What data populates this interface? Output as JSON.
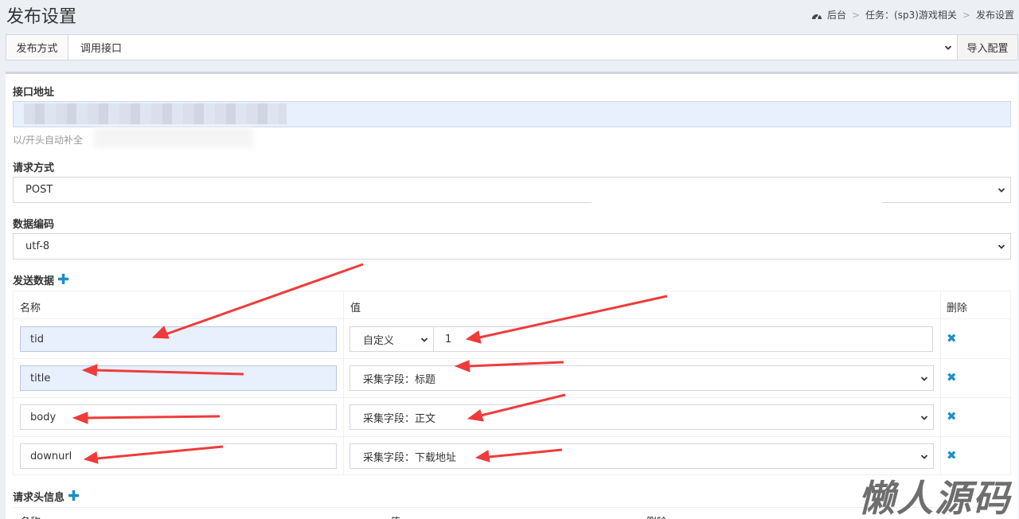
{
  "header": {
    "title": "发布设置",
    "breadcrumb": [
      "后台",
      "任务：(sp3)游戏相关",
      "发布设置"
    ]
  },
  "method_bar": {
    "label": "发布方式",
    "selected": "调用接口",
    "import_button": "导入配置"
  },
  "api": {
    "label": "接口地址",
    "help": "以/开头自动补全"
  },
  "request_method": {
    "label": "请求方式",
    "selected": "POST"
  },
  "encoding": {
    "label": "数据编码",
    "selected": "utf-8"
  },
  "send_data": {
    "label": "发送数据",
    "columns": [
      "名称",
      "值",
      "删除"
    ],
    "rows": [
      {
        "name": "tid",
        "value_type": "自定义",
        "value": "1"
      },
      {
        "name": "title",
        "value": "采集字段：标题"
      },
      {
        "name": "body",
        "value": "采集字段：正文"
      },
      {
        "name": "downurl",
        "value": "采集字段：下载地址"
      }
    ]
  },
  "request_headers": {
    "label": "请求头信息",
    "columns": [
      "名称",
      "值",
      "删除"
    ]
  },
  "watermark": "懒人源码",
  "colors": {
    "accent": "#1b8fc4",
    "arrow": "#ef3b3b",
    "autofill": "#e8f0fe"
  }
}
